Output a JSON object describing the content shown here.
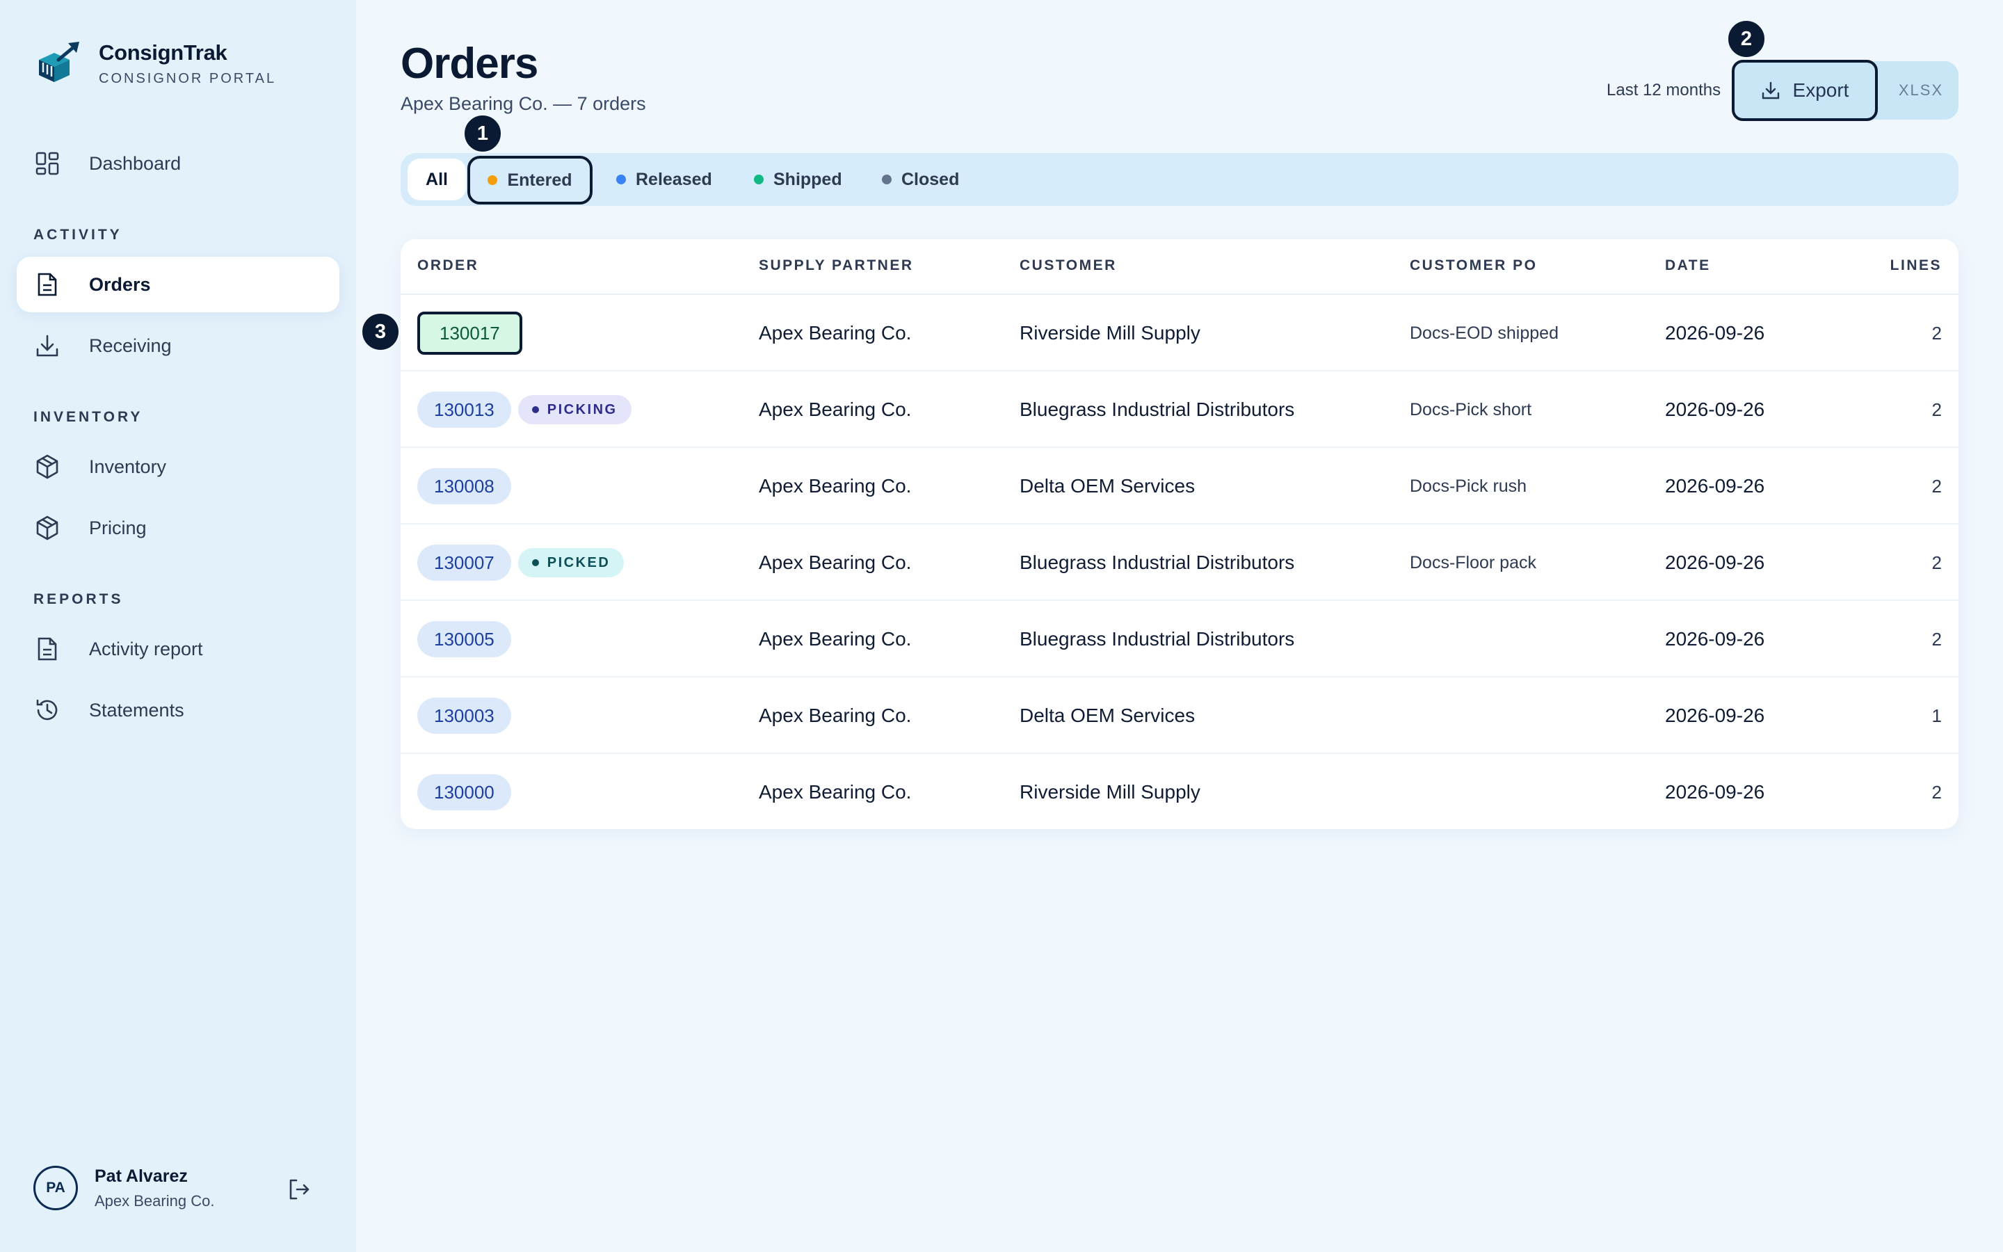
{
  "brand": {
    "name": "ConsignTrak",
    "subtitle": "CONSIGNOR PORTAL"
  },
  "sidebar": {
    "top_items": [
      {
        "label": "Dashboard",
        "icon": "dashboard-icon"
      }
    ],
    "sections": [
      {
        "label": "ACTIVITY",
        "items": [
          {
            "label": "Orders",
            "icon": "document-icon",
            "active": true
          },
          {
            "label": "Receiving",
            "icon": "download-icon"
          }
        ]
      },
      {
        "label": "INVENTORY",
        "items": [
          {
            "label": "Inventory",
            "icon": "box-icon"
          },
          {
            "label": "Pricing",
            "icon": "box-icon"
          }
        ]
      },
      {
        "label": "REPORTS",
        "items": [
          {
            "label": "Activity report",
            "icon": "document-icon"
          },
          {
            "label": "Statements",
            "icon": "history-icon"
          }
        ]
      }
    ]
  },
  "user": {
    "initials": "PA",
    "name": "Pat Alvarez",
    "org": "Apex Bearing Co."
  },
  "header": {
    "title": "Orders",
    "subtitle": "Apex Bearing Co. — 7 orders",
    "range": "Last 12 months",
    "export_label": "Export",
    "xlsx_label": "XLSX"
  },
  "badges": {
    "one": "1",
    "two": "2",
    "three": "3"
  },
  "filters": [
    {
      "label": "All",
      "color": ""
    },
    {
      "label": "Entered",
      "color": "#f59e0b"
    },
    {
      "label": "Released",
      "color": "#3b82f6"
    },
    {
      "label": "Shipped",
      "color": "#10b981"
    },
    {
      "label": "Closed",
      "color": "#64748b"
    }
  ],
  "table": {
    "columns": [
      "ORDER",
      "SUPPLY PARTNER",
      "CUSTOMER",
      "CUSTOMER PO",
      "DATE",
      "LINES"
    ],
    "rows": [
      {
        "order": "130017",
        "status": "",
        "partner": "Apex Bearing Co.",
        "customer": "Riverside Mill Supply",
        "po": "Docs-EOD shipped",
        "date": "2026-09-26",
        "lines": "2",
        "selected": true
      },
      {
        "order": "130013",
        "status": "PICKING",
        "partner": "Apex Bearing Co.",
        "customer": "Bluegrass Industrial Distributors",
        "po": "Docs-Pick short",
        "date": "2026-09-26",
        "lines": "2"
      },
      {
        "order": "130008",
        "status": "",
        "partner": "Apex Bearing Co.",
        "customer": "Delta OEM Services",
        "po": "Docs-Pick rush",
        "date": "2026-09-26",
        "lines": "2"
      },
      {
        "order": "130007",
        "status": "PICKED",
        "partner": "Apex Bearing Co.",
        "customer": "Bluegrass Industrial Distributors",
        "po": "Docs-Floor pack",
        "date": "2026-09-26",
        "lines": "2"
      },
      {
        "order": "130005",
        "status": "",
        "partner": "Apex Bearing Co.",
        "customer": "Bluegrass Industrial Distributors",
        "po": "",
        "date": "2026-09-26",
        "lines": "2"
      },
      {
        "order": "130003",
        "status": "",
        "partner": "Apex Bearing Co.",
        "customer": "Delta OEM Services",
        "po": "",
        "date": "2026-09-26",
        "lines": "1"
      },
      {
        "order": "130000",
        "status": "",
        "partner": "Apex Bearing Co.",
        "customer": "Riverside Mill Supply",
        "po": "",
        "date": "2026-09-26",
        "lines": "2"
      }
    ]
  }
}
